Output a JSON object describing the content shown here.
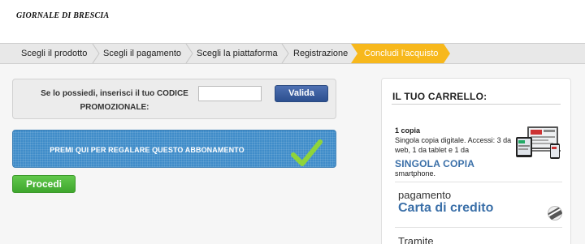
{
  "header": {
    "logo_text": "GIORNALE DI BRESCIA"
  },
  "steps": [
    {
      "label": "Scegli il prodotto",
      "active": false
    },
    {
      "label": "Scegli il pagamento",
      "active": false
    },
    {
      "label": "Scegli la piattaforma",
      "active": false
    },
    {
      "label": "Registrazione",
      "active": false
    },
    {
      "label": "Concludi l'acquisto",
      "active": true
    }
  ],
  "colors": {
    "active_step": "#f7b81c",
    "valida_button": "#2c4f8f",
    "gift_banner": "#3f8cc9",
    "procedi_button": "#4cb33a",
    "cart_link": "#3a6fa8"
  },
  "promo": {
    "label": "Se lo possiedi, inserisci il tuo CODICE PROMOZIONALE:",
    "input_value": "",
    "input_placeholder": "",
    "button_label": "Valida"
  },
  "gift": {
    "text": "PREMI QUI PER REGALARE QUESTO ABBONAMENTO",
    "icon": "checkmark-icon"
  },
  "procedi_label": "Procedi",
  "cart": {
    "title": "IL TUO CARRELLO:",
    "item": {
      "quantity": "1 copia",
      "description": "Singola copia digitale. Accessi: 3 da web, 1 da tablet e 1 da",
      "name": "SINGOLA COPIA",
      "description_end": "smartphone.",
      "icon": "newspaper-devices-icon"
    },
    "payment_label": "pagamento",
    "payment_method": "Carta di credito",
    "payment_icon": "credit-card-icon",
    "tramite_label": "Tramite"
  }
}
